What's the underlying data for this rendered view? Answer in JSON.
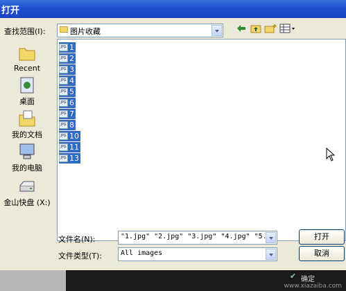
{
  "window": {
    "title": "打开"
  },
  "lookin": {
    "label": "查找范围(I):",
    "value": "图片收藏"
  },
  "places": [
    {
      "label": "Recent",
      "icon": "recent-folder-icon"
    },
    {
      "label": "桌面",
      "icon": "desktop-icon"
    },
    {
      "label": "我的文档",
      "icon": "my-documents-icon"
    },
    {
      "label": "我的电脑",
      "icon": "my-computer-icon"
    },
    {
      "label": "金山快盘 (X:)",
      "icon": "drive-icon"
    }
  ],
  "files": [
    {
      "name": "1"
    },
    {
      "name": "2"
    },
    {
      "name": "3"
    },
    {
      "name": "4"
    },
    {
      "name": "5"
    },
    {
      "name": "6"
    },
    {
      "name": "7"
    },
    {
      "name": "8"
    },
    {
      "name": "10"
    },
    {
      "name": "11"
    },
    {
      "name": "13"
    }
  ],
  "filename": {
    "label": "文件名(N):",
    "value": "\"1.jpg\" \"2.jpg\" \"3.jpg\" \"4.jpg\" \"5.jp"
  },
  "filetype": {
    "label": "文件类型(T):",
    "value": "All images"
  },
  "buttons": {
    "open": "打开",
    "cancel": "取消",
    "confirm": "确定"
  },
  "watermark": "www.xiazaiba.com",
  "colors": {
    "selection": "#316ac5",
    "titlebar": "#1f4fd0"
  }
}
